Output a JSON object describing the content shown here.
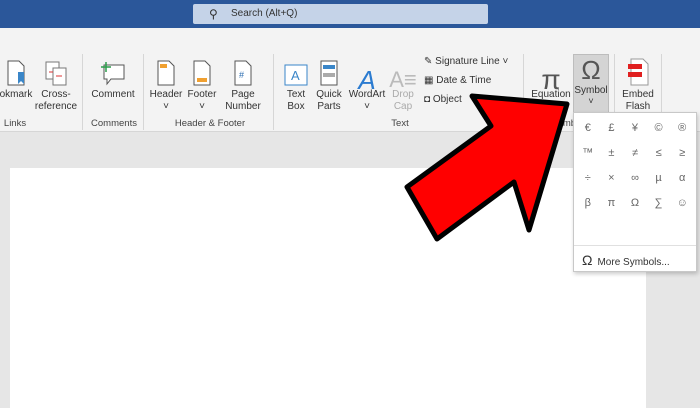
{
  "search": {
    "placeholder": "Search (Alt+Q)"
  },
  "ribbon": {
    "buttons": {
      "bookmark": "okmark",
      "cross_reference": "Cross-\nreference",
      "comment": "Comment",
      "header": "Header",
      "footer": "Footer",
      "page_number": "Page\nNumber",
      "text_box": "Text\nBox",
      "quick_parts": "Quick\nParts",
      "wordart": "WordArt",
      "drop_cap": "Drop\nCap",
      "signature_line": "Signature Line",
      "date_time": "Date & Time",
      "object": "Object",
      "equation": "Equation",
      "symbol": "Symbol",
      "embed_flash": "Embed\nFlash"
    },
    "groups": {
      "links": "Links",
      "comments": "Comments",
      "header_footer": "Header & Footer",
      "text": "Text",
      "symbols": "Symbols"
    }
  },
  "symbol_menu": {
    "symbols": [
      "€",
      "£",
      "¥",
      "©",
      "®",
      "™",
      "±",
      "≠",
      "≤",
      "≥",
      "÷",
      "×",
      "∞",
      "µ",
      "α",
      "β",
      "π",
      "Ω",
      "∑",
      "☺"
    ],
    "more": "More Symbols..."
  },
  "colors": {
    "titlebar": "#2b579a",
    "arrow": "#ff0000"
  }
}
